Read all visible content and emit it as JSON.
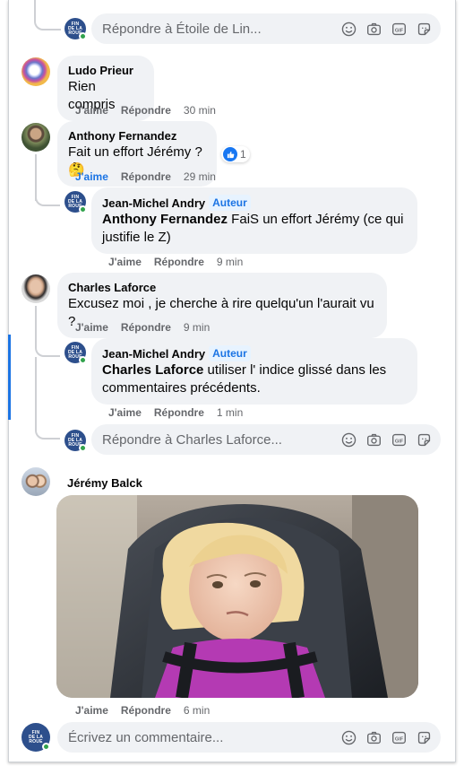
{
  "page_owner": {
    "avatar_text": [
      "FIN",
      "DE LA",
      "ROUE"
    ]
  },
  "reply_boxes": {
    "top": "Répondre à Étoile de Lin...",
    "charles": "Répondre à Charles Laforce...",
    "main": "Écrivez un commentaire..."
  },
  "actions": {
    "like": "J'aime",
    "reply": "Répondre"
  },
  "comments": [
    {
      "author": "Ludo Prieur",
      "text": "Rien compris",
      "time": "30 min"
    },
    {
      "author": "Anthony Fernandez",
      "text": "Fait un effort Jérémy ? 🤔",
      "time": "29 min",
      "reactions": "1"
    },
    {
      "author": "Jean-Michel Andry",
      "badge": "Auteur",
      "mention": "Anthony Fernandez",
      "text": " FaiS un effort Jérémy (ce qui justifie le Z)",
      "time": "9 min"
    },
    {
      "author": "Charles Laforce",
      "text": "Excusez moi , je cherche à rire quelqu'un l'aurait vu ?",
      "time": "9 min"
    },
    {
      "author": "Jean-Michel Andry",
      "badge": "Auteur",
      "mention": "Charles Laforce",
      "text": " utiliser l' indice glissé dans les commentaires précédents.",
      "time": "1 min"
    },
    {
      "author": "Jérémy Balck",
      "time": "6 min"
    }
  ],
  "icons": [
    "smiley-icon",
    "camera-icon",
    "gif-icon",
    "sticker-icon",
    "like-icon"
  ],
  "colors": {
    "bubble": "#f0f2f5",
    "accent": "#1b74e4",
    "muted": "#65676b",
    "badge_bg": "#e7f3ff"
  }
}
